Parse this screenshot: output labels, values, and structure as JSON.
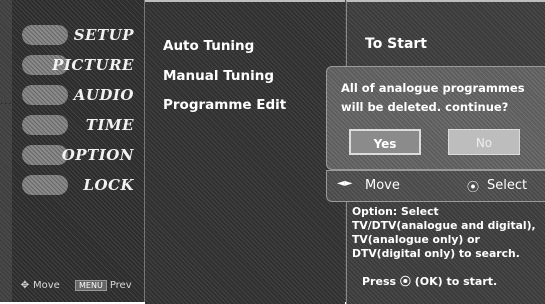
{
  "sidebar": {
    "items": [
      {
        "label": "SETUP",
        "icon": "setup-icon"
      },
      {
        "label": "PICTURE",
        "icon": "picture-icon"
      },
      {
        "label": "AUDIO",
        "icon": "audio-icon"
      },
      {
        "label": "TIME",
        "icon": "time-icon"
      },
      {
        "label": "OPTION",
        "icon": "option-icon"
      },
      {
        "label": "LOCK",
        "icon": "lock-icon"
      }
    ],
    "footer": {
      "move_icon": "✥",
      "move_label": "Move",
      "menu_key": "MENU",
      "prev_label": "Prev"
    }
  },
  "submenu": {
    "items": [
      "Auto Tuning",
      "Manual Tuning",
      "Programme Edit"
    ]
  },
  "right_panel": {
    "title": "To Start"
  },
  "popup": {
    "message": "All of analogue programmes will be deleted. continue?",
    "yes_label": "Yes",
    "no_label": "No"
  },
  "navbar": {
    "arrows": "◄►",
    "move_label": "Move",
    "select_icon": "⦿",
    "select_label": "Select"
  },
  "help": {
    "option_text": "Option: Select TV/DTV(analogue and digital), TV(analogue only) or DTV(digital only) to search.",
    "press_prefix": "Press ",
    "press_icon": "⦿",
    "press_suffix": " (OK) to start."
  },
  "colors": {
    "panel": "#3f3f3f",
    "text": "#ffffff",
    "button_focus": "#8b8b8b",
    "button_idle": "#bdbdbd"
  }
}
